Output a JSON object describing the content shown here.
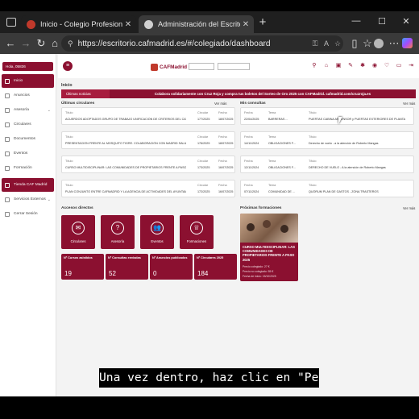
{
  "browser": {
    "tabs": [
      {
        "title": "Inicio - Colegio Profesional de Ad",
        "active": false
      },
      {
        "title": "Administración del Escritorio CAF",
        "active": true
      }
    ],
    "new_tab": "+",
    "window_controls": {
      "minimize": "—",
      "maximize": "☐",
      "close": "✕"
    },
    "url": "https://escritorio.cafmadrid.es/#/colegiado/dashboard",
    "nav": {
      "back": "←",
      "forward": "→",
      "reload": "↻",
      "home": "⌂"
    }
  },
  "sidebar": {
    "user": "Hola, 05836",
    "items": [
      {
        "label": "Inicio",
        "active": true,
        "chevron": false
      },
      {
        "label": "Anuncios",
        "active": false,
        "chevron": false
      },
      {
        "label": "Asesoría",
        "active": false,
        "chevron": true
      },
      {
        "label": "Circulares",
        "active": false,
        "chevron": false
      },
      {
        "label": "Documentos",
        "active": false,
        "chevron": false
      },
      {
        "label": "Eventos",
        "active": false,
        "chevron": false
      },
      {
        "label": "Formación",
        "active": false,
        "chevron": false
      },
      {
        "label": "Tienda CAF Madrid",
        "active": true,
        "chevron": false
      },
      {
        "label": "Servicios Externos",
        "active": false,
        "chevron": true
      },
      {
        "label": "Cerrar Sesión",
        "active": false,
        "chevron": false
      }
    ]
  },
  "header": {
    "logo": "CAFMadrid",
    "breadcrumb": "Inicio"
  },
  "banner": {
    "label": "Últimas noticias",
    "text": "Colabora solidariamente con Cruz Roja y compra tus boletos del Sorteo de Oro 2025 con CAFMadrid. cafmadrid.com/cruzroja.es"
  },
  "circulares": {
    "title": "Últimas circulares",
    "ver_mas": "Ver más",
    "headers": {
      "title": "Título",
      "circular": "Circular",
      "fecha": "Fecha"
    },
    "rows": [
      {
        "titulo": "ACUERDOS ADOPTADOS GRUPO DE TRABAJO UNIFICACIÓN DE CRITERIOS DEL CATASTRO...",
        "circular": "177/2025",
        "fecha": "18/07/2025"
      },
      {
        "titulo": "PRESENTACIÓN FRENTE AL MOSQUITO TIGRE. COLABORACIÓN CON MADRID SALUD...",
        "circular": "176/2025",
        "fecha": "18/07/2025"
      },
      {
        "titulo": "CURSO MULTIDISCIPLINAR: LAS COMUNIDADES DE PROPIETARIOS FRENTE A PASO 2025",
        "circular": "173/2025",
        "fecha": "16/07/2025"
      },
      {
        "titulo": "PLAN CONJUNTO ENTRE CAFMADRID Y LA AGENCIA DE ACTIVIDADES DEL AYUNTAMIENTO DE...",
        "circular": "172/2025",
        "fecha": "16/07/2025"
      }
    ]
  },
  "consultas": {
    "title": "Mis consultas",
    "ver_mas": "Ver más",
    "headers": {
      "fecha": "Fecha",
      "tema": "Tema",
      "titulo": "Título"
    },
    "rows": [
      {
        "fecha": "22/04/2025",
        "tema": "BARRERAS ...",
        "titulo": "PUERTAS CABINA ASCENSOR y PUERTAS EXTERIORES DE PLANTA"
      },
      {
        "fecha": "14/11/2024",
        "tema": "OBLIGACIONES F...",
        "titulo": "Derecho de vuelo - a la atención de Roberto Mangas"
      },
      {
        "fecha": "12/11/2024",
        "tema": "OBLIGACIONES F...",
        "titulo": "DERECHO DE VUELO - A la atención de Roberto Mangas"
      },
      {
        "fecha": "07/11/2024",
        "tema": "COMUNIDAD DE ...",
        "titulo": "QUORUM PLAN DE GASTOS - ZONA TRASTEROS"
      }
    ]
  },
  "accesos": {
    "title": "Accesos directos",
    "tiles": [
      {
        "label": "Circulares",
        "icon": "envelope-icon",
        "glyph": "✉"
      },
      {
        "label": "Asesoría",
        "icon": "question-icon",
        "glyph": "?"
      },
      {
        "label": "Eventos",
        "icon": "people-icon",
        "glyph": "👥"
      },
      {
        "label": "Formaciones",
        "icon": "award-icon",
        "glyph": "♕"
      }
    ]
  },
  "stats": [
    {
      "label": "Nº Cursos asistidos",
      "value": "19"
    },
    {
      "label": "Nº Consultas enviadas",
      "value": "52"
    },
    {
      "label": "Nº Anuncios publicados",
      "value": "0"
    },
    {
      "label": "Nº Circulares 2025",
      "value": "184"
    }
  ],
  "formaciones": {
    "title": "Próximas formaciones",
    "ver_mas": "Ver más",
    "card": {
      "title": "CURSO MULTIDISCIPLINAR: LAS COMUNIDADES DE PROPIETARIOS FRENTE A PASO 2025",
      "precio_colegiado": "Precio colegiado: 27 €",
      "precio_no_colegiado": "Precio no colegiado: 55 €",
      "fecha": "Fecha de inicio: 15/10/2025"
    }
  },
  "caption": "Una vez dentro, haz clic en \"Perfil\"",
  "colors": {
    "accent": "#8b1030",
    "browser_chrome": "#3a3a3a"
  }
}
